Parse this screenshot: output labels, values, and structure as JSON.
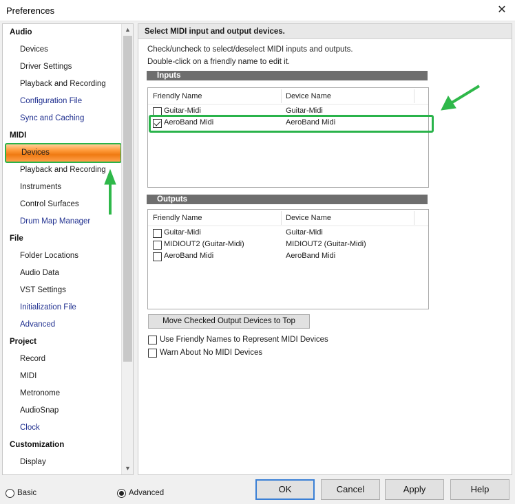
{
  "window": {
    "title": "Preferences",
    "close_glyph": "✕"
  },
  "sidebar": {
    "nodes": [
      {
        "kind": "cat",
        "label": "Audio"
      },
      {
        "kind": "item",
        "label": "Devices"
      },
      {
        "kind": "item",
        "label": "Driver Settings"
      },
      {
        "kind": "item",
        "label": "Playback and Recording"
      },
      {
        "kind": "link",
        "label": "Configuration File"
      },
      {
        "kind": "link",
        "label": "Sync and Caching"
      },
      {
        "kind": "cat",
        "label": "MIDI"
      },
      {
        "kind": "item",
        "label": "Devices",
        "selected": true
      },
      {
        "kind": "item",
        "label": "Playback and Recording"
      },
      {
        "kind": "item",
        "label": "Instruments"
      },
      {
        "kind": "item",
        "label": "Control Surfaces"
      },
      {
        "kind": "link",
        "label": "Drum Map Manager"
      },
      {
        "kind": "cat",
        "label": "File"
      },
      {
        "kind": "item",
        "label": "Folder Locations"
      },
      {
        "kind": "item",
        "label": "Audio Data"
      },
      {
        "kind": "item",
        "label": "VST Settings"
      },
      {
        "kind": "link",
        "label": "Initialization File"
      },
      {
        "kind": "link",
        "label": "Advanced"
      },
      {
        "kind": "cat",
        "label": "Project"
      },
      {
        "kind": "item",
        "label": "Record"
      },
      {
        "kind": "item",
        "label": "MIDI"
      },
      {
        "kind": "item",
        "label": "Metronome"
      },
      {
        "kind": "item",
        "label": "AudioSnap"
      },
      {
        "kind": "link",
        "label": "Clock"
      },
      {
        "kind": "cat",
        "label": "Customization"
      },
      {
        "kind": "item",
        "label": "Display"
      }
    ],
    "scroll_up_glyph": "▲",
    "scroll_down_glyph": "▼"
  },
  "panel": {
    "header": "Select MIDI input and output devices.",
    "instruction_1": "Check/uncheck to select/deselect MIDI inputs and outputs.",
    "instruction_2": "Double-click on a friendly name to edit it.",
    "inputs": {
      "section_title": "Inputs",
      "col_friendly": "Friendly Name",
      "col_device": "Device Name",
      "rows": [
        {
          "friendly": "Guitar-Midi",
          "device": "Guitar-Midi",
          "checked": false
        },
        {
          "friendly": "AeroBand Midi",
          "device": "AeroBand Midi",
          "checked": true
        }
      ]
    },
    "outputs": {
      "section_title": "Outputs",
      "col_friendly": "Friendly Name",
      "col_device": "Device Name",
      "rows": [
        {
          "friendly": "Guitar-Midi",
          "device": "Guitar-Midi",
          "checked": false
        },
        {
          "friendly": "MIDIOUT2 (Guitar-Midi)",
          "device": "MIDIOUT2 (Guitar-Midi)",
          "checked": false
        },
        {
          "friendly": "AeroBand Midi",
          "device": "AeroBand Midi",
          "checked": false
        }
      ]
    },
    "move_button": "Move Checked Output Devices to Top",
    "option_friendly_names": {
      "label": "Use Friendly Names to Represent MIDI Devices",
      "checked": false
    },
    "option_warn_no_midi": {
      "label": "Warn About No MIDI Devices",
      "checked": false
    }
  },
  "footer": {
    "basic_label": "Basic",
    "advanced_label": "Advanced",
    "mode_selected": "Advanced",
    "ok": "OK",
    "cancel": "Cancel",
    "apply": "Apply",
    "help": "Help"
  },
  "colors": {
    "highlight": "#29b34a",
    "selected_item": "#ef7a12",
    "section_bar": "#6e6e6e"
  },
  "icons": {
    "close": "close-icon",
    "arrow": "arrow-annotation",
    "scroll_up": "chevron-up-icon",
    "scroll_down": "chevron-down-icon"
  }
}
